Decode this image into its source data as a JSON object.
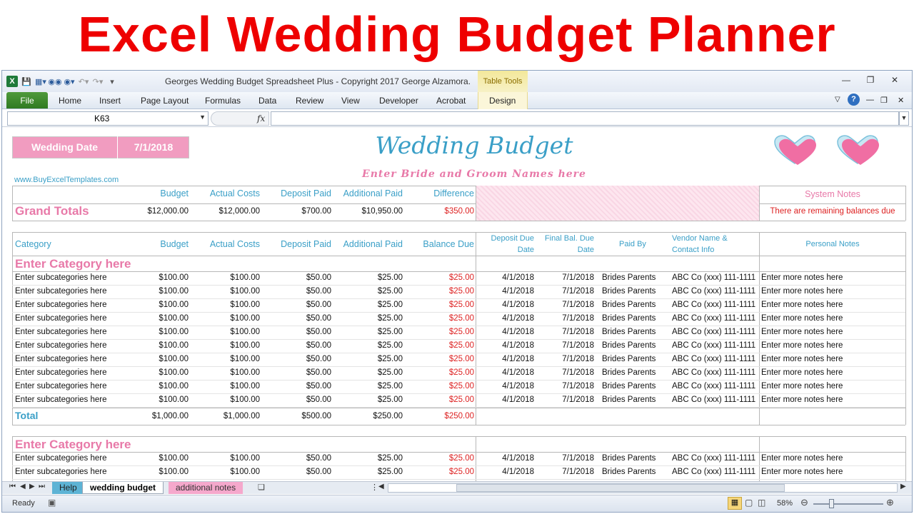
{
  "banner": {
    "title": "Excel Wedding Budget Planner"
  },
  "window": {
    "title": "Georges Wedding Budget Spreadsheet Plus - Copyright 2017 George Alzamora....",
    "table_tools": "Table Tools"
  },
  "ribbon": {
    "file": "File",
    "tabs": [
      "Home",
      "Insert",
      "Page Layout",
      "Formulas",
      "Data",
      "Review",
      "View",
      "Developer",
      "Acrobat",
      "Design"
    ]
  },
  "formula_bar": {
    "name_box": "K63",
    "fx": "fx",
    "formula": ""
  },
  "sheet": {
    "wedding_date_label": "Wedding Date",
    "wedding_date_value": "7/1/2018",
    "title": "Wedding Budget",
    "subtitle": "Enter Bride and Groom Names here",
    "website": "www.BuyExcelTemplates.com",
    "grand_headers": [
      "Budget",
      "Actual Costs",
      "Deposit Paid",
      "Additional Paid",
      "Difference"
    ],
    "grand_label": "Grand Totals",
    "grand_values": [
      "$12,000.00",
      "$12,000.00",
      "$700.00",
      "$10,950.00",
      "$350.00"
    ],
    "system_notes_label": "System Notes",
    "system_notes_text": "There are remaining balances due",
    "table_headers": {
      "category": "Category",
      "budget": "Budget",
      "actual": "Actual Costs",
      "deposit": "Deposit Paid",
      "additional": "Additional Paid",
      "balance": "Balance Due",
      "deposit_due_1": "Deposit Due",
      "deposit_due_2": "Date",
      "final_due_1": "Final Bal. Due",
      "final_due_2": "Date",
      "paid_by": "Paid By",
      "vendor_1": "Vendor Name &",
      "vendor_2": "Contact Info",
      "notes": "Personal Notes"
    },
    "category_1": "Enter Category here",
    "category_2": "Enter Category here",
    "rows": [
      {
        "sub": "Enter subcategories here",
        "budget": "$100.00",
        "actual": "$100.00",
        "deposit": "$50.00",
        "additional": "$25.00",
        "balance": "$25.00",
        "dep_date": "4/1/2018",
        "final_date": "7/1/2018",
        "paid_by": "Brides Parents",
        "vendor": "ABC Co (xxx) 111-1111",
        "notes": "Enter more notes here"
      }
    ],
    "row_count_1": 10,
    "row_count_2": 2,
    "total_label": "Total",
    "total_values": [
      "$1,000.00",
      "$1,000.00",
      "$500.00",
      "$250.00",
      "$250.00"
    ]
  },
  "sheet_tabs": [
    "Help",
    "wedding budget",
    "additional notes"
  ],
  "status": {
    "ready": "Ready",
    "zoom": "58%"
  },
  "colors": {
    "accent_blue": "#3a9fc7",
    "accent_pink": "#e879a8",
    "balance_red": "#dd2222",
    "banner_red": "#ee0000"
  }
}
